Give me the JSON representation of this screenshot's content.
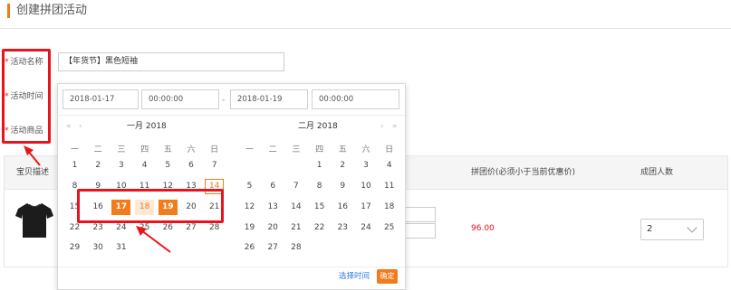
{
  "page": {
    "title": "创建拼团活动"
  },
  "form": {
    "labels": {
      "required_mark": "*",
      "activity_name": "活动名称",
      "activity_time": "活动时间",
      "activity_product": "活动商品"
    },
    "activity_name_value": "【年货节】黑色短袖"
  },
  "table": {
    "headers": {
      "product_desc": "宝贝描述",
      "group_price": "拼团价(必须小于当前优惠价)",
      "group_size": "成团人数"
    },
    "row": {
      "price": "96.00",
      "group_size_value": "2",
      "image": "black-tshirt"
    }
  },
  "datepicker": {
    "start_date": "2018-01-17",
    "start_time": "00:00:00",
    "separator": "-",
    "end_date": "2018-01-19",
    "end_time": "00:00:00",
    "nav": {
      "prev_year": "«",
      "prev_month": "‹",
      "next_month": "›",
      "next_year": "»"
    },
    "left_month_title": "一月 2018",
    "right_month_title": "二月 2018",
    "weekdays": [
      "一",
      "二",
      "三",
      "四",
      "五",
      "六",
      "日"
    ],
    "left_weeks": [
      [
        "1",
        "2",
        "3",
        "4",
        "5",
        "6",
        "7"
      ],
      [
        "8",
        "9",
        "10",
        "11",
        "12",
        "13",
        "14"
      ],
      [
        "15",
        "16",
        "17",
        "18",
        "19",
        "20",
        "21"
      ],
      [
        "22",
        "23",
        "24",
        "25",
        "26",
        "27",
        "28"
      ],
      [
        "29",
        "30",
        "31",
        "",
        "",
        "",
        ""
      ]
    ],
    "right_weeks": [
      [
        "",
        "",
        "",
        "1",
        "2",
        "3",
        "4"
      ],
      [
        "5",
        "6",
        "7",
        "8",
        "9",
        "10",
        "11"
      ],
      [
        "12",
        "13",
        "14",
        "15",
        "16",
        "17",
        "18"
      ],
      [
        "19",
        "20",
        "21",
        "22",
        "23",
        "24",
        "25"
      ],
      [
        "26",
        "27",
        "28",
        "",
        "",
        "",
        ""
      ]
    ],
    "selected_days": [
      "17",
      "19"
    ],
    "range_days": [
      "18"
    ],
    "today": "14",
    "select_time_label": "选择时间",
    "confirm_label": "确定"
  },
  "colors": {
    "accent": "#f27b1c",
    "annotation_red": "#e8141b",
    "link": "#2f7ed8"
  }
}
